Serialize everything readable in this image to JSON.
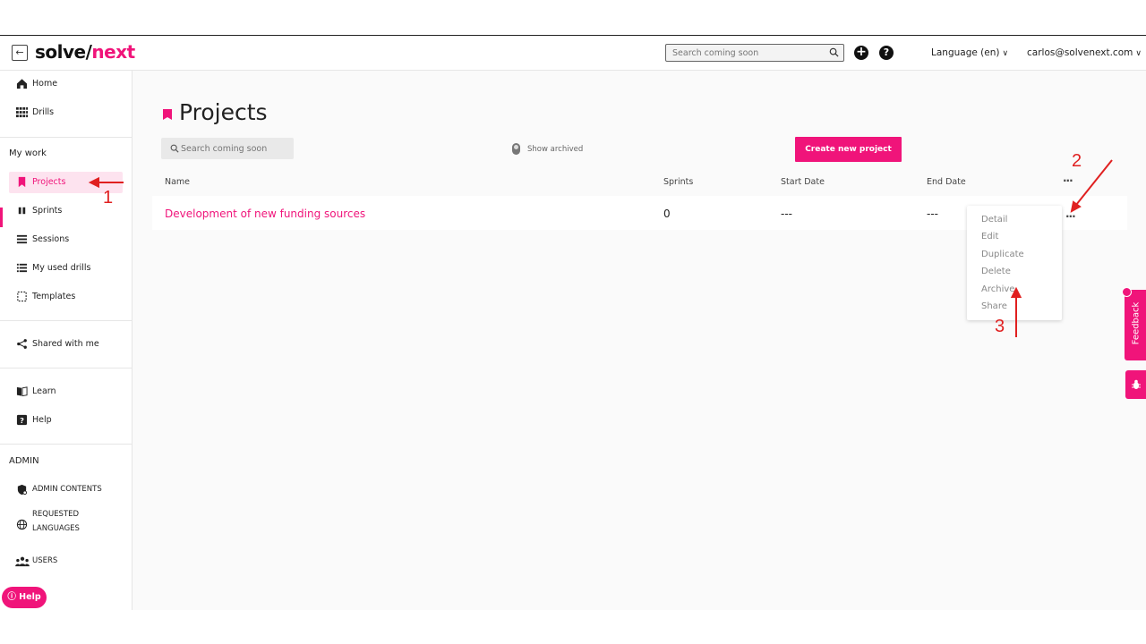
{
  "header": {
    "logo_part1": "solve/",
    "logo_part2": "next",
    "search_placeholder": "Search coming soon",
    "language_label": "Language (en)",
    "user_email": "carlos@solvenext.com"
  },
  "sidebar": {
    "items_top": [
      {
        "label": "Home",
        "icon": "home-icon"
      },
      {
        "label": "Drills",
        "icon": "grid-icon"
      }
    ],
    "my_work_label": "My work",
    "my_work_items": [
      {
        "label": "Projects",
        "icon": "bookmark-icon",
        "active": true
      },
      {
        "label": "Sprints",
        "icon": "pause-icon"
      },
      {
        "label": "Sessions",
        "icon": "list-icon"
      },
      {
        "label": "My used drills",
        "icon": "list-bullets-icon"
      },
      {
        "label": "Templates",
        "icon": "dashed-square-icon"
      }
    ],
    "shared_label": "Shared with me",
    "learn_label": "Learn",
    "help_label": "Help",
    "admin_label": "ADMIN",
    "admin_items": [
      {
        "label": "ADMIN CONTENTS",
        "icon": "shield-icon"
      },
      {
        "label_line1": "REQUESTED",
        "label_line2": "LANGUAGES",
        "icon": "globe-icon"
      },
      {
        "label": "USERS",
        "icon": "users-icon"
      }
    ],
    "help_pill": "Help"
  },
  "main": {
    "title": "Projects",
    "search_placeholder": "Search coming soon",
    "show_archived_label": "Show archived",
    "create_button": "Create new project",
    "columns": [
      "Name",
      "Sprints",
      "Start Date",
      "End Date",
      "···"
    ],
    "rows": [
      {
        "name": "Development of new funding sources",
        "sprints": "0",
        "start_date": "---",
        "end_date": "---",
        "actions": "···"
      }
    ],
    "menu_items": [
      "Detail",
      "Edit",
      "Duplicate",
      "Delete",
      "Archive",
      "Share"
    ]
  },
  "feedback": {
    "label": "Feedback"
  },
  "annotations": {
    "n1": "1",
    "n2": "2",
    "n3": "3"
  },
  "colors": {
    "brand": "#f0147a",
    "annotation": "#e02020"
  }
}
